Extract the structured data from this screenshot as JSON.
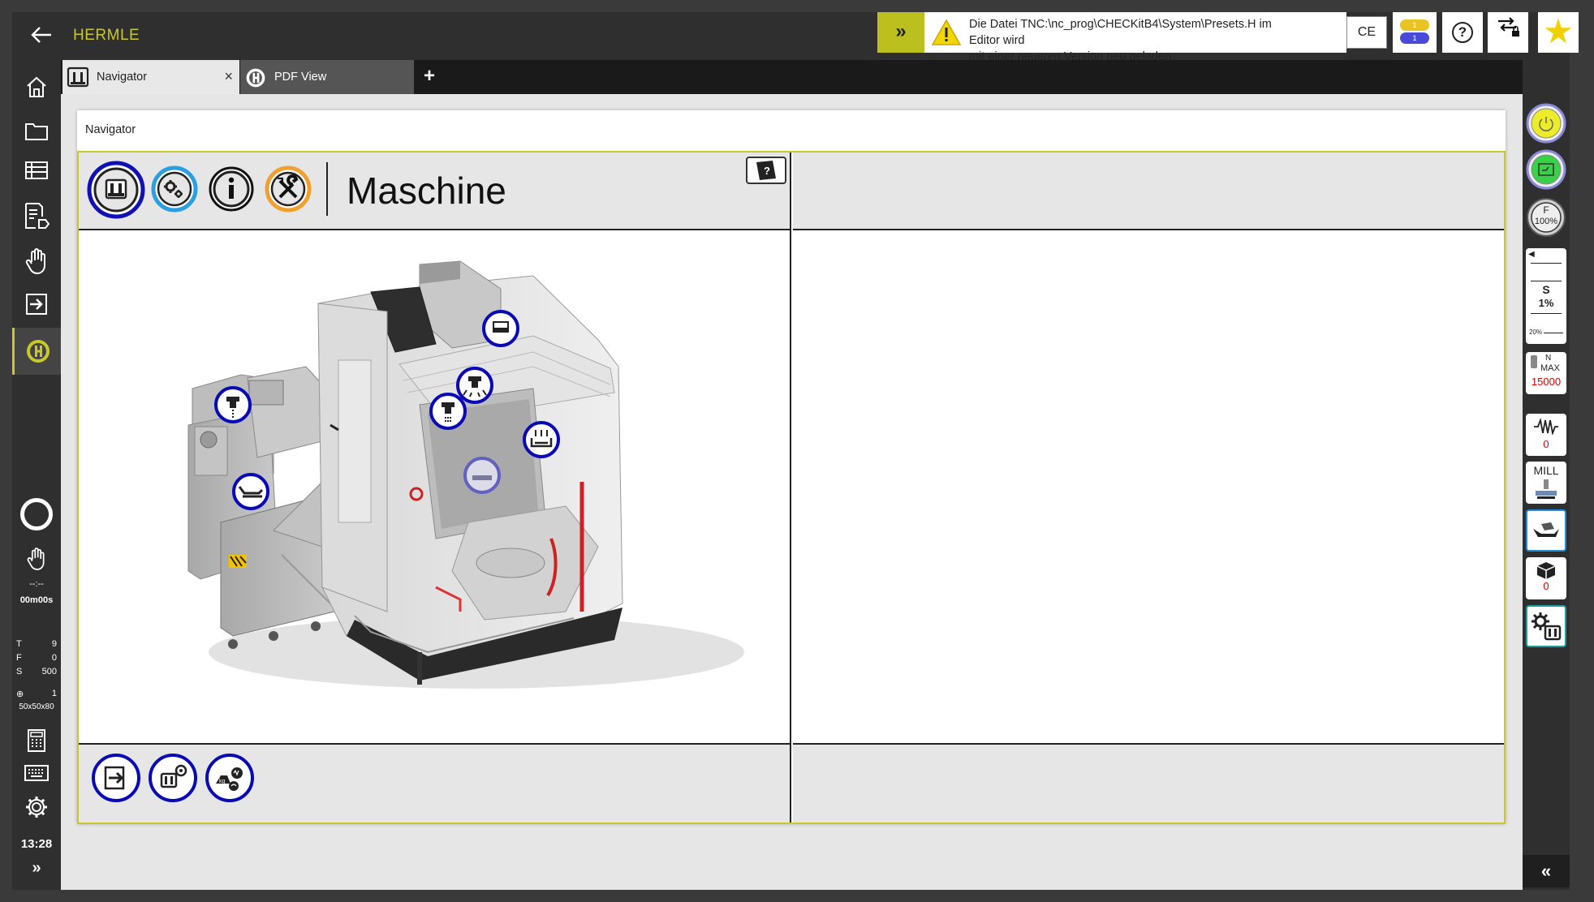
{
  "app": {
    "title": "HERMLE",
    "back_label": "Back"
  },
  "notification": {
    "text_line1": "Die Datei TNC:\\nc_prog\\CHECKitB4\\System\\Presets.H im Editor wird",
    "text_line2": "mit einer neueren Version neu geladen",
    "expand_label": "»"
  },
  "toolbar": {
    "ce_label": "CE",
    "program_count_top": "1",
    "program_count_bottom": "1",
    "help_label": "?",
    "favorite_label": "★"
  },
  "tabs": [
    {
      "label": "Navigator",
      "close": "×"
    },
    {
      "label": "PDF View"
    }
  ],
  "tab_add_label": "+",
  "panel": {
    "title": "Navigator",
    "mode_title": "Maschine"
  },
  "left_status": {
    "time_placeholder": "--:--",
    "elapsed": "00m00s",
    "rows": [
      {
        "k": "T",
        "v": "9"
      },
      {
        "k": "F",
        "v": "0"
      },
      {
        "k": "S",
        "v": "500"
      },
      {
        "k": "⊕",
        "v": "1"
      }
    ],
    "blank_size": "50x50x80",
    "clock": "13:28",
    "expand": "»"
  },
  "right_status": {
    "feed_label": "F",
    "feed_override": "100%",
    "spindle_label": "S",
    "spindle_override": "1%",
    "spindle_min": "20%",
    "nmax_label_n": "N",
    "nmax_label_max": "MAX",
    "nmax_value": "15000",
    "vibration_value": "0",
    "mill_label": "MILL",
    "parts_count": "0",
    "collapse": "«"
  },
  "colors": {
    "accent": "#c8c82a",
    "frame": "#2f2f2f",
    "hotspot_blue": "#0a0ab4",
    "warning_yellow": "#f2d600"
  }
}
